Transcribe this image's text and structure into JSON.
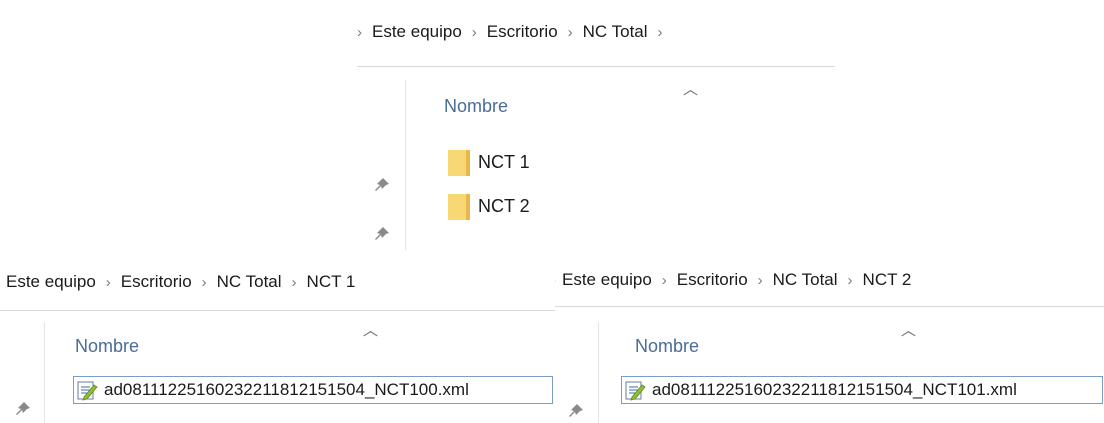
{
  "top": {
    "breadcrumb": [
      "Este equipo",
      "Escritorio",
      "NC Total"
    ],
    "column_header": "Nombre",
    "folders": [
      "NCT 1",
      "NCT 2"
    ]
  },
  "bottom_left": {
    "breadcrumb": [
      "Este equipo",
      "Escritorio",
      "NC Total",
      "NCT 1"
    ],
    "column_header": "Nombre",
    "file": "ad08111225160232211812151504_NCT100.xml"
  },
  "bottom_right": {
    "breadcrumb": [
      "Este equipo",
      "Escritorio",
      "NC Total",
      "NCT 2"
    ],
    "column_header": "Nombre",
    "file": "ad08111225160232211812151504_NCT101.xml"
  },
  "icons": {
    "separator": "chevron-right-icon",
    "sort": "sort-ascending-caret-icon",
    "pin": "pin-icon",
    "folder": "folder-icon",
    "file": "xml-file-icon"
  },
  "colors": {
    "column_header": "#4a6c9a",
    "selection_border": "#7a9cc9",
    "folder": "#f8d775"
  }
}
